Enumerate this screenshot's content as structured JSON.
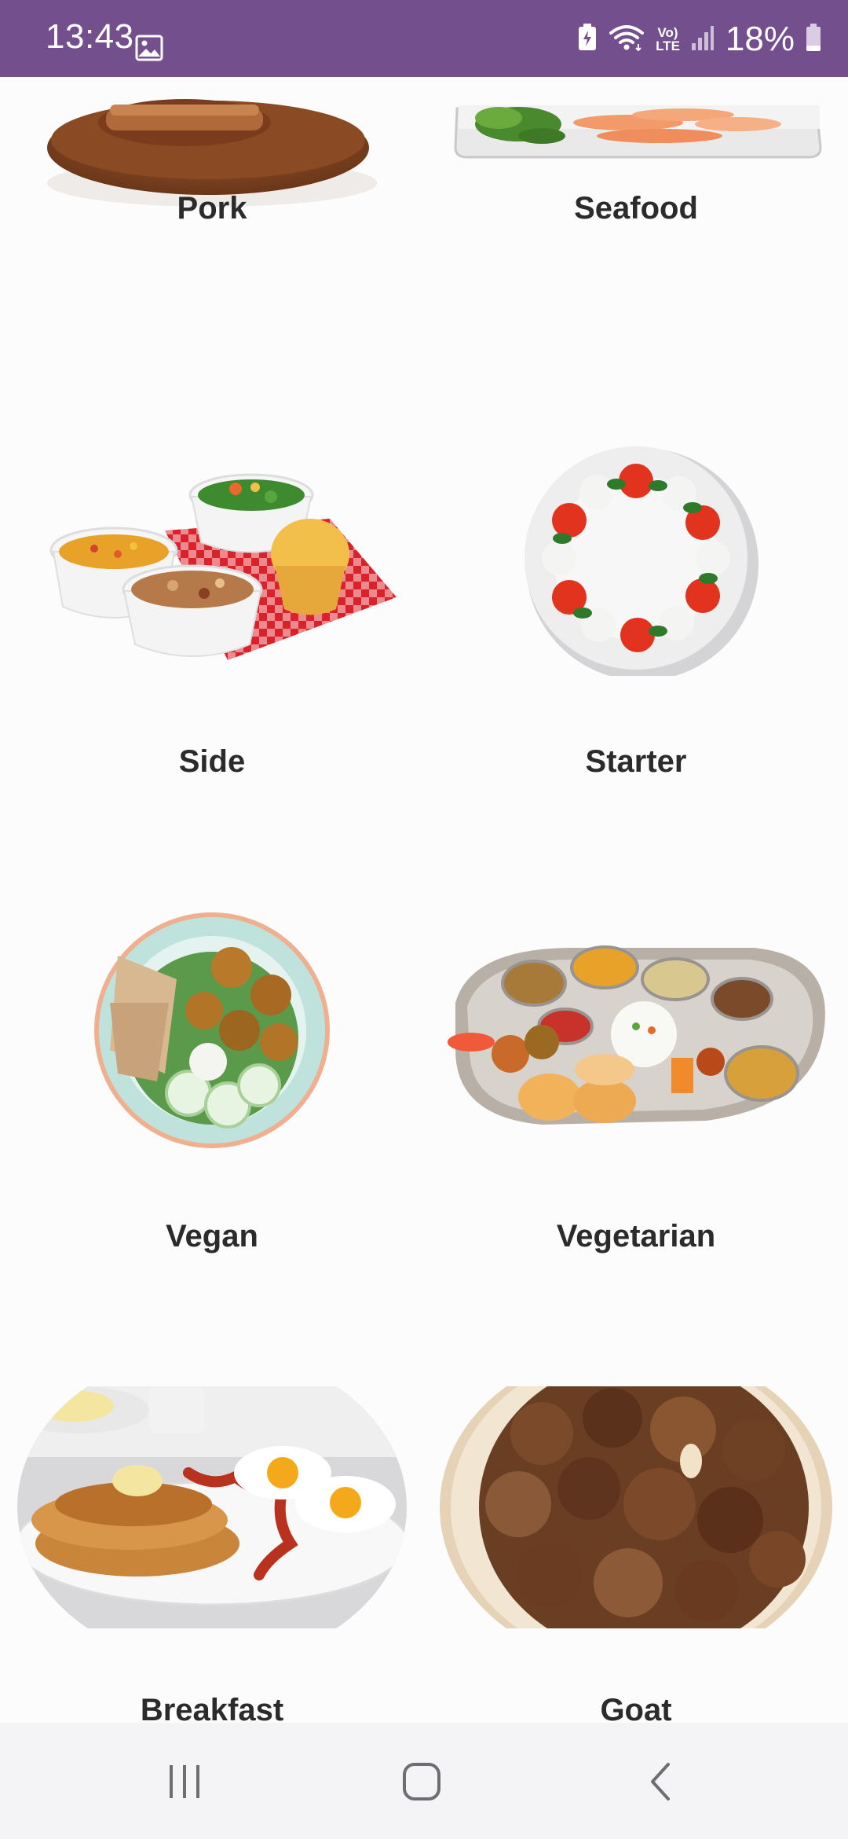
{
  "status_bar": {
    "time": "13:43",
    "battery_percent": "18%",
    "icons": [
      "gallery-icon",
      "battery-saver-icon",
      "wifi-icon",
      "volte-icon",
      "signal-icon",
      "battery-icon"
    ],
    "volte_label_top": "Vo)",
    "volte_label_bottom": "LTE",
    "background_color": "#744f8d"
  },
  "categories": [
    {
      "label": "Pork",
      "image": "pork-dish-image"
    },
    {
      "label": "Seafood",
      "image": "seafood-platter-image"
    },
    {
      "label": "Side",
      "image": "side-dishes-image"
    },
    {
      "label": "Starter",
      "image": "caprese-starter-image"
    },
    {
      "label": "Vegan",
      "image": "vegan-bowl-image"
    },
    {
      "label": "Vegetarian",
      "image": "vegetarian-thali-image"
    },
    {
      "label": "Breakfast",
      "image": "pancake-breakfast-image"
    },
    {
      "label": "Goat",
      "image": "goat-curry-image"
    }
  ],
  "nav_bar": {
    "buttons": [
      "recent-apps-button",
      "home-button",
      "back-button"
    ]
  }
}
